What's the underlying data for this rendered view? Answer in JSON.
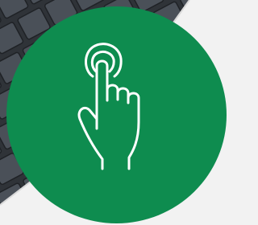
{
  "colors": {
    "badge": "#0e8c4f",
    "icon_stroke": "#ffffff",
    "background": "#f2f2f2",
    "keyboard_dark": "#2f3338",
    "keyboard_key": "#4a5058"
  },
  "icons": {
    "main": "tap-gesture-icon"
  }
}
